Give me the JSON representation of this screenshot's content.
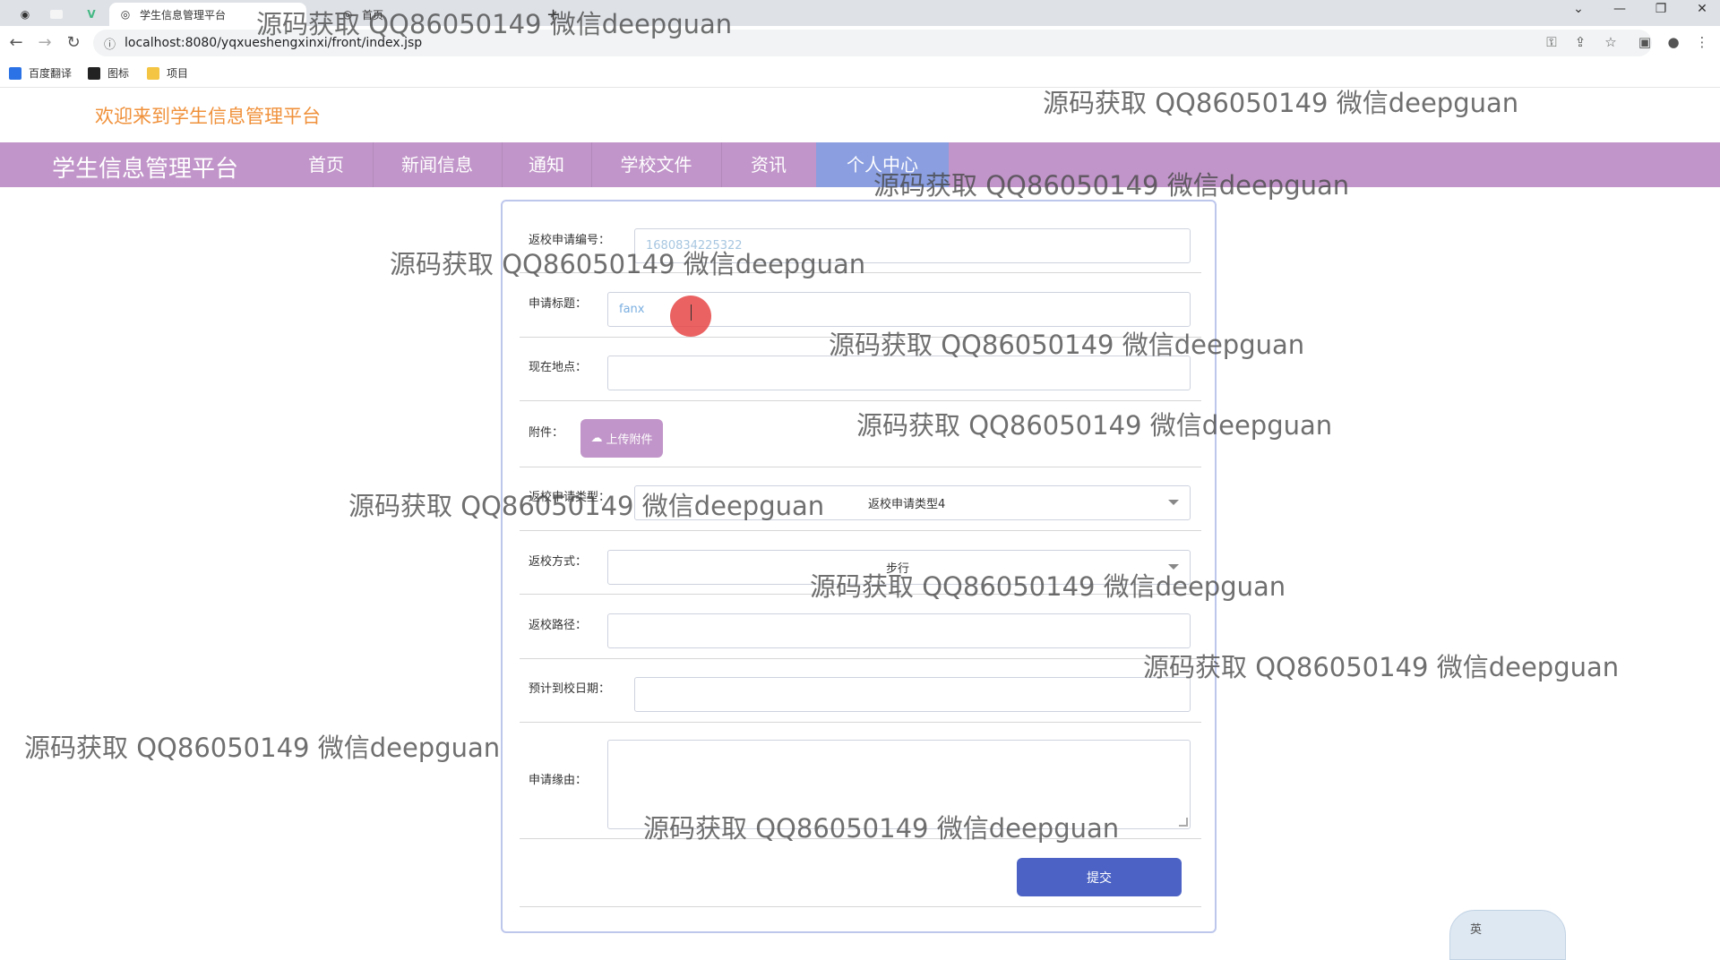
{
  "browser": {
    "tabs": [
      {
        "label": ""
      },
      {
        "label": "学生信息管理平台"
      },
      {
        "label": "首页"
      }
    ],
    "url": "localhost:8080/yqxueshengxinxi/front/index.jsp",
    "bookmarks": [
      "百度翻译",
      "图标",
      "项目"
    ]
  },
  "header": {
    "welcome": "欢迎来到学生信息管理平台"
  },
  "navbar": {
    "brand": "学生信息管理平台",
    "items": [
      "首页",
      "新闻信息",
      "通知",
      "学校文件",
      "资讯",
      "个人中心"
    ],
    "active_index": 5
  },
  "form": {
    "fields": {
      "application_no": {
        "label": "返校申请编号：",
        "value": "1680834225322"
      },
      "title": {
        "label": "申请标题：",
        "value": "fanx"
      },
      "location": {
        "label": "现在地点：",
        "value": ""
      },
      "attachment": {
        "label": "附件：",
        "button": "上传附件"
      },
      "type": {
        "label": "返校申请类型：",
        "value": "返校申请类型4"
      },
      "method": {
        "label": "返校方式：",
        "value": "步行"
      },
      "route": {
        "label": "返校路径：",
        "value": ""
      },
      "date": {
        "label": "预计到校日期：",
        "value": ""
      },
      "reason": {
        "label": "申请缘由：",
        "value": ""
      }
    },
    "submit": "提交"
  },
  "watermark_text": "源码获取 QQ86050149 微信deepguan",
  "ime_label": "英",
  "colors": {
    "navbar": "#c195c9",
    "nav_active": "#8a9ee0",
    "welcome": "#f0913b",
    "submit": "#4c63c5"
  }
}
